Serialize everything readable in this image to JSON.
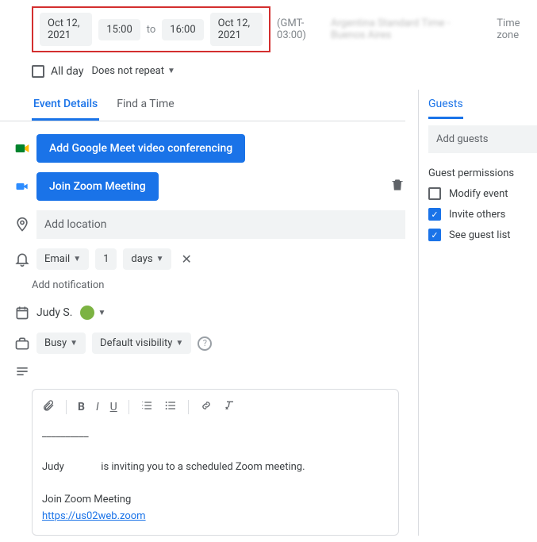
{
  "datetime": {
    "start_date": "Oct 12, 2021",
    "start_time": "15:00",
    "to": "to",
    "end_time": "16:00",
    "end_date": "Oct 12, 2021",
    "tz_offset": "(GMT-03:00)",
    "tz_name": "Argentina Standard Time - Buenos Aires",
    "tz_label": "Time zone"
  },
  "allday": {
    "label": "All day",
    "repeat": "Does not repeat"
  },
  "tabs": {
    "details": "Event Details",
    "find_time": "Find a Time"
  },
  "meet": {
    "add": "Add Google Meet video conferencing"
  },
  "zoom": {
    "join": "Join Zoom Meeting"
  },
  "location": {
    "placeholder": "Add location"
  },
  "notification": {
    "method": "Email",
    "count": "1",
    "unit": "days",
    "add": "Add notification"
  },
  "owner": {
    "name": "Judy S."
  },
  "visibility": {
    "busy": "Busy",
    "default": "Default visibility"
  },
  "description": {
    "line_sep": "__________",
    "inviter": "Judy",
    "invite_text": "is inviting you to a scheduled Zoom meeting.",
    "join_label": "Join Zoom Meeting",
    "url": "https://us02web.zoom"
  },
  "guests": {
    "header": "Guests",
    "placeholder": "Add guests",
    "perm_title": "Guest permissions",
    "modify": "Modify event",
    "invite": "Invite others",
    "see_list": "See guest list"
  }
}
